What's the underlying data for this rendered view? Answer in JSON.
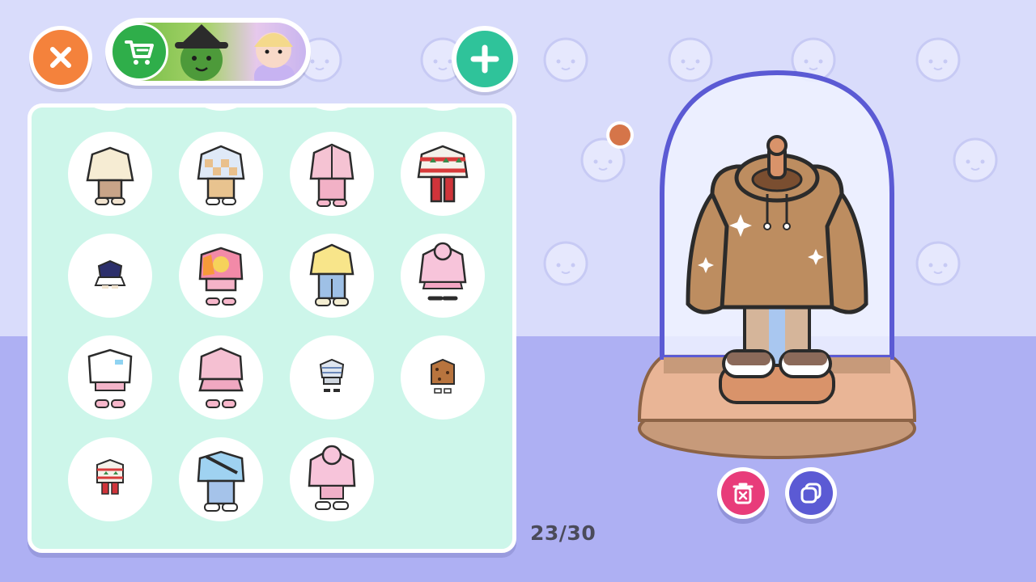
{
  "toolbar": {
    "close_icon": "close-icon",
    "shop_icon": "shopping-cart-icon",
    "add_icon": "plus-icon"
  },
  "outfit_panel": {
    "rows": [
      [
        "cream-jacket-outfit",
        "blue-checkered-outfit",
        "pink-zip-outfit",
        "christmas-sweater-outfit"
      ],
      [
        "navy-top-small",
        "tie-dye-outfit",
        "yellow-sweater-jeans-outfit",
        "pink-hoodie-dress-outfit"
      ],
      [
        "white-tee-pink-outfit",
        "pink-cardigan-skirt-outfit",
        "striped-shirt-small",
        "leopard-coat-small"
      ],
      [
        "christmas-sweater-small",
        "blue-sweatshirt-outfit",
        "pink-hoodie-outfit"
      ]
    ]
  },
  "counter": {
    "text": "23/30"
  },
  "display_case": {
    "selected_outfit": "brown-hoodie-outfit",
    "delete_icon": "trash-icon",
    "copy_icon": "duplicate-icon"
  },
  "colors": {
    "background": "#d9dcfb",
    "floor": "#aeb0f3",
    "panel": "#cdf6ea",
    "close": "#f4823c",
    "shop": "#2fae4a",
    "add": "#2fc39a",
    "delete": "#e83c7a",
    "copy": "#5b5ad4",
    "color_dot": "#d57549"
  }
}
